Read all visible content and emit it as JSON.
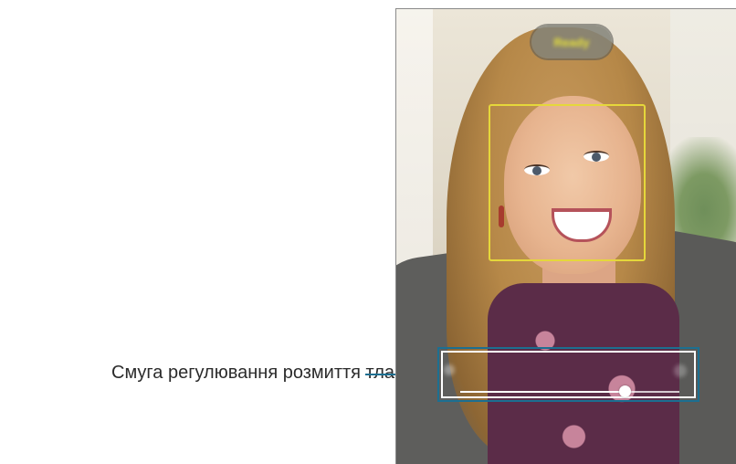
{
  "callout": {
    "label": "Смуга регулювання розмиття тла",
    "color": "#1c6f91"
  },
  "camera": {
    "status_pill": {
      "text": "Ready",
      "text_color": "#e8e23a"
    },
    "face_frame_color": "#e5d73b",
    "blur_slider": {
      "value_fraction": 0.75
    }
  }
}
